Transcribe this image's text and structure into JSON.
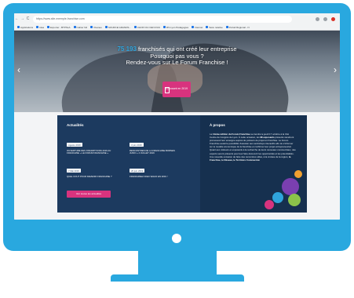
{
  "browser": {
    "url": "https://www.site-exemple-franchise.com",
    "nav_back": "←",
    "nav_forward": "→",
    "nav_reload": "C",
    "bookmarks": [
      "Applications",
      "Idea",
      "Exporter - BTPSLA",
      "Cahier Nd",
      "Vivaneo",
      "SOURCE GRANDS...",
      "CHOIX DU CEN RUU",
      "RS Lyon Pédagogies",
      "Internet",
      "Sécu relative",
      "Portail Régional - N"
    ]
  },
  "hero": {
    "number": "75 193",
    "line1_rest": "franchisés qui ont créé leur entreprise",
    "line2": "Pourquoi pas vous ?",
    "line3": "Rendez-vous sur Le Forum Franchise !",
    "cta_label": "Exposant en 2019",
    "arrow_left": "‹",
    "arrow_right": "›"
  },
  "news": {
    "title": "Actualités",
    "items": [
      {
        "date": "Agosto 2019",
        "title": "OUVERTURE DES INSCRIPTIONS 2019 AU FRANCHISE « LE FORUM FRANCHISE »"
      },
      {
        "date": "3 juin 2019",
        "title": "RENCONTRES DE LA FRANCHISE BORNES JUNIO « 4 JUILLET 2019"
      },
      {
        "date": "7 Mai 2019",
        "title": "QUEL COUT POUR DEVENIR FRANCHISE ?"
      },
      {
        "date": "20 juin 2019",
        "title": "FRANCHISEZ AVEC WALKI EN 2019 !"
      }
    ],
    "button": "Voir toutes les actualités"
  },
  "about": {
    "title": "À propos",
    "pre_edition": "La ",
    "edition": "11ème édition du Forum Franchise",
    "after_edition": " se tiendra le jeudi 17 octobre à la Cité Centre de Congrès de Lyon. À cette occasion, les ",
    "count": "98 exposants",
    "middle": " présents viendront promouvoir leur enseigne auprès de porteurs de projet en franchise. Le Forum Franchise aurait la possibilité d'assister aux workshops interactifs afin de s'informer sur le modèle économique de la franchise et confirmer leur projet entrepreneurial. Quant aux visiteurs et exposants à la recherche de leurs nouveaux commerciaux, des experts seront présents pour leur faire découvrir les opportunités et les potentialités. Une nouvelle occasion de faire des rencontres utiles, à la croisée de la région, ",
    "final": "la Franchise, le Réseau, le Territoire Commercial."
  },
  "colors": {
    "frame": "#29a8df",
    "accent_pink": "#d8337e",
    "navy": "#1c3a5f",
    "hero_highlight": "#2fa4dc"
  }
}
